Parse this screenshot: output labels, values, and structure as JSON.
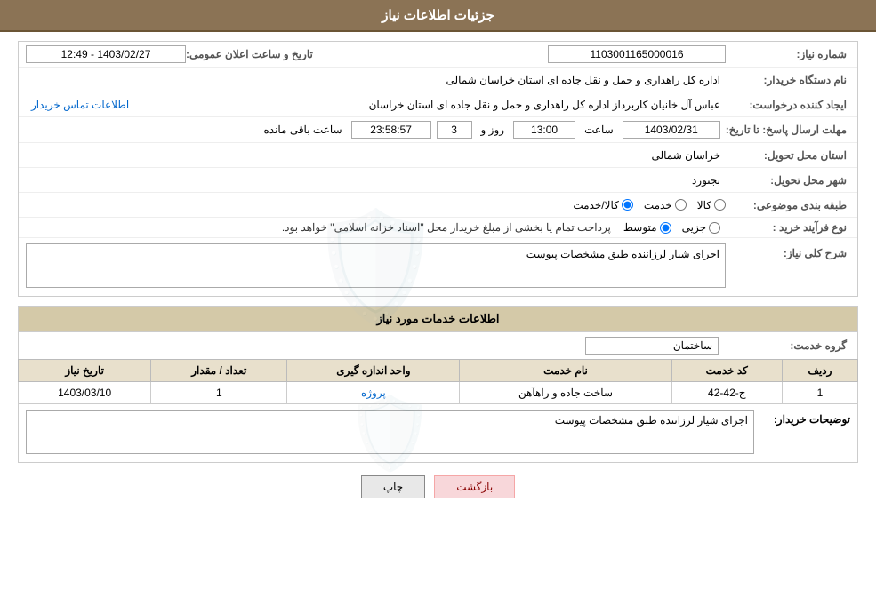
{
  "header": {
    "title": "جزئیات اطلاعات نیاز"
  },
  "fields": {
    "need_number_label": "شماره نیاز:",
    "need_number_value": "1103001165000016",
    "buyer_org_label": "نام دستگاه خریدار:",
    "buyer_org_value": "اداره کل راهداری و حمل و نقل جاده ای استان خراسان شمالی",
    "announce_datetime_label": "تاریخ و ساعت اعلان عمومی:",
    "announce_datetime_value": "1403/02/27 - 12:49",
    "creator_label": "ایجاد کننده درخواست:",
    "creator_value": "عباس آل خانیان کاربرداز اداره کل راهداری و حمل و نقل جاده ای استان خراسان",
    "contact_link": "اطلاعات تماس خریدار",
    "deadline_label": "مهلت ارسال پاسخ: تا تاریخ:",
    "deadline_date": "1403/02/31",
    "deadline_time_label": "ساعت",
    "deadline_time": "13:00",
    "deadline_days_label": "روز و",
    "deadline_days": "3",
    "deadline_remaining_label": "ساعت باقی مانده",
    "deadline_remaining": "23:58:57",
    "delivery_province_label": "استان محل تحویل:",
    "delivery_province_value": "خراسان شمالی",
    "delivery_city_label": "شهر محل تحویل:",
    "delivery_city_value": "بجنورد",
    "category_label": "طبقه بندی موضوعی:",
    "category_kala": "کالا",
    "category_khadamat": "خدمت",
    "category_kala_khadamat": "کالا/خدمت",
    "process_label": "نوع فرآیند خرید :",
    "process_jezii": "جزیی",
    "process_motevaset": "متوسط",
    "process_detail": "پرداخت تمام یا بخشی از مبلغ خریداز محل \"اسناد خزانه اسلامی\" خواهد بود.",
    "description_label": "شرح کلی نیاز:",
    "description_value": "اجرای شیار لرزاننده طبق مشخصات پیوست",
    "services_section_title": "اطلاعات خدمات مورد نیاز",
    "group_service_label": "گروه خدمت:",
    "group_service_value": "ساختمان",
    "table_headers": {
      "row_num": "ردیف",
      "service_code": "کد خدمت",
      "service_name": "نام خدمت",
      "unit": "واحد اندازه گیری",
      "quantity": "تعداد / مقدار",
      "need_date": "تاریخ نیاز"
    },
    "table_row": {
      "row_num": "1",
      "service_code": "ج-42-42",
      "service_name": "ساخت جاده و راهآهن",
      "unit": "پروژه",
      "quantity": "1",
      "need_date": "1403/03/10"
    },
    "buyer_desc_label": "توضیحات خریدار:",
    "buyer_desc_value": "اجرای شیار لرزاننده طبق مشخصات پیوست",
    "btn_print": "چاپ",
    "btn_back": "بازگشت"
  }
}
